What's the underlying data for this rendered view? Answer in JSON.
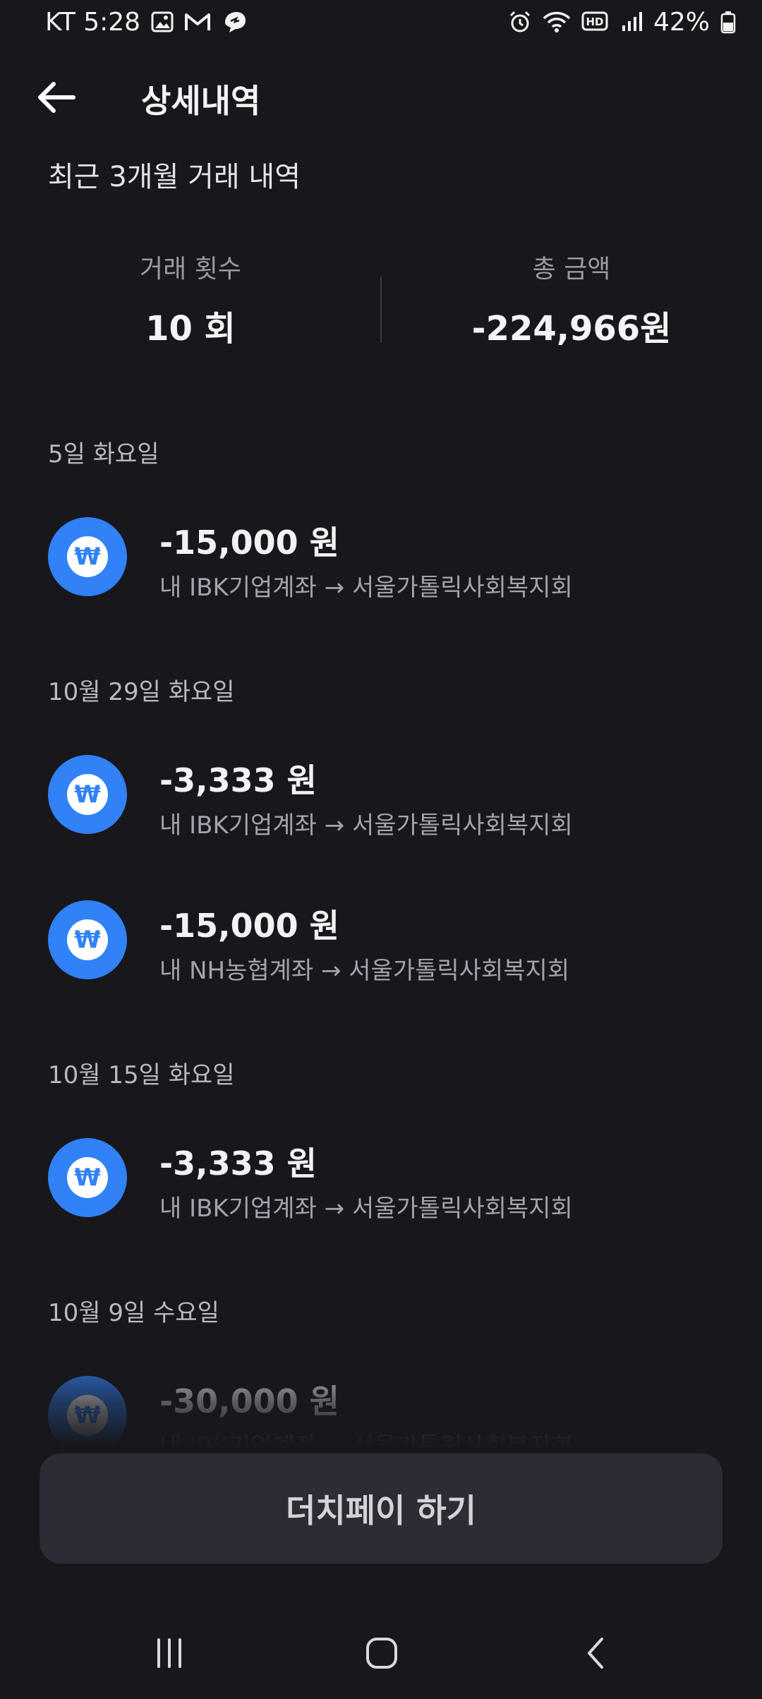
{
  "status_bar": {
    "carrier_time": "KT 5:28",
    "battery": "42%",
    "left_icons": [
      "image-icon",
      "gmail-icon",
      "thread-icon"
    ],
    "right_icons": [
      "alarm-icon",
      "wifi-icon",
      "hd-icon",
      "signal-icon",
      "battery-icon"
    ]
  },
  "header": {
    "back_icon": "arrow-left-icon",
    "title": "상세내역"
  },
  "subtitle": "최근 3개월 거래 내역",
  "summary": {
    "count_label": "거래 횟수",
    "count_value": "10 회",
    "total_label": "총 금액",
    "total_value": "-224,966원"
  },
  "groups": [
    {
      "date": "5일 화요일",
      "transactions": [
        {
          "amount": "-15,000 원",
          "description": "내 IBK기업계좌 → 서울가톨릭사회복지회",
          "icon": "won-icon"
        }
      ]
    },
    {
      "date": "10월 29일 화요일",
      "transactions": [
        {
          "amount": "-3,333 원",
          "description": "내 IBK기업계좌 → 서울가톨릭사회복지회",
          "icon": "won-icon"
        },
        {
          "amount": "-15,000 원",
          "description": "내 NH농협계좌 → 서울가톨릭사회복지회",
          "icon": "won-icon"
        }
      ]
    },
    {
      "date": "10월 15일 화요일",
      "transactions": [
        {
          "amount": "-3,333 원",
          "description": "내 IBK기업계좌 → 서울가톨릭사회복지회",
          "icon": "won-icon"
        }
      ]
    },
    {
      "date": "10월 9일 수요일",
      "transactions": [
        {
          "amount": "-30,000 원",
          "description": "내 IBK기업계좌 → 서울가톨릭사회복지회",
          "icon": "won-icon"
        }
      ]
    }
  ],
  "won_symbol": "₩",
  "dutch_pay_button": "더치페이 하기",
  "nav_bar": {
    "icons": [
      "recent-apps-icon",
      "home-icon",
      "back-icon"
    ]
  },
  "colors": {
    "background": "#17171c",
    "accent": "#3182f6",
    "button_bg": "#2c2c35"
  }
}
